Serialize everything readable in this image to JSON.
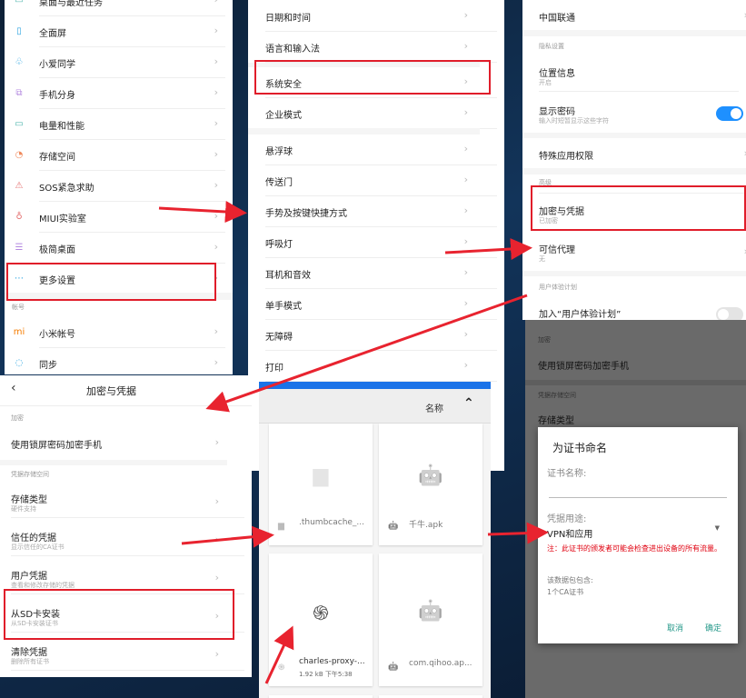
{
  "panel_a": {
    "items": [
      {
        "label": "桌面与最近任务",
        "icon": "desktop-icon",
        "color": "#4db6ac"
      },
      {
        "label": "全面屏",
        "icon": "phone-icon",
        "color": "#29a3e0"
      },
      {
        "label": "小爱同学",
        "icon": "xiaoai-icon",
        "color": "#29a3e0"
      },
      {
        "label": "手机分身",
        "icon": "dual-icon",
        "color": "#b48ae0"
      },
      {
        "label": "电量和性能",
        "icon": "battery-icon",
        "color": "#4db6ac"
      },
      {
        "label": "存储空间",
        "icon": "storage-icon",
        "color": "#f08a5d"
      },
      {
        "label": "SOS紧急求助",
        "icon": "warning-icon",
        "color": "#e57373"
      },
      {
        "label": "MIUI实验室",
        "icon": "flask-icon",
        "color": "#e57373"
      },
      {
        "label": "极简桌面",
        "icon": "simple-desktop-icon",
        "color": "#b48ae0"
      },
      {
        "label": "更多设置",
        "icon": "more-icon",
        "color": "#29a3e0"
      }
    ],
    "account_section": "帐号",
    "account_items": [
      {
        "label": "小米帐号",
        "icon": "mi-icon",
        "color": "#f57c00"
      },
      {
        "label": "同步",
        "icon": "sync-icon",
        "color": "#29a3e0"
      }
    ]
  },
  "panel_b": {
    "group1": [
      "日期和时间",
      "语言和输入法"
    ],
    "group2": [
      "系统安全",
      "企业模式"
    ],
    "group3": [
      "悬浮球",
      "传送门",
      "手势及按键快捷方式",
      "呼吸灯",
      "耳机和音效",
      "单手模式",
      "无障碍",
      "打印"
    ]
  },
  "panel_c": {
    "carrier": "中国联通",
    "privacy_section": "隐私设置",
    "location": {
      "title": "位置信息",
      "sub": "开启"
    },
    "show_password": {
      "title": "显示密码",
      "sub": "输入时短暂显示这些字符",
      "on": true
    },
    "special_perm": "特殊应用权限",
    "advanced_section": "高级",
    "encryption": {
      "title": "加密与凭据",
      "sub": "已加密"
    },
    "trust_agents": {
      "title": "可信代理",
      "sub": "无"
    },
    "ux_section": "用户体验计划",
    "ux_join": {
      "title": "加入“用户体验计划”",
      "on": false
    }
  },
  "panel_d": {
    "section1": "加密",
    "item1": "使用锁屏密码加密手机",
    "section2": "凭据存储空间",
    "item2": "存储类型",
    "dialog": {
      "title": "为证书命名",
      "name_label": "证书名称:",
      "name_value": "",
      "usage_label": "凭据用途:",
      "usage_value": "VPN和应用",
      "warning": "注：此证书的颁发者可能会检查进出设备的所有流量。",
      "contains_label": "该数据包包含:",
      "contains_value": "1个CA证书",
      "cancel": "取消",
      "ok": "确定",
      "accent": "#26998a",
      "warning_color": "#e0000f"
    }
  },
  "panel_e": {
    "title": "加密与凭据",
    "section1": "加密",
    "item_encrypt": "使用锁屏密码加密手机",
    "section2": "凭据存储空间",
    "items": [
      {
        "title": "存储类型",
        "sub": "硬件支持"
      },
      {
        "title": "信任的凭据",
        "sub": "显示信任的CA证书"
      },
      {
        "title": "用户凭据",
        "sub": "查看和修改存储的凭据"
      },
      {
        "title": "从SD卡安装",
        "sub": "从SD卡安装证书"
      },
      {
        "title": "清除凭据",
        "sub": "删除所有证书"
      }
    ]
  },
  "panel_f": {
    "sort_label": "名称",
    "accent": "#1a73e8",
    "files": [
      {
        "name": ".thumbcache_...",
        "icon": "file-icon"
      },
      {
        "name": "千牛.apk",
        "icon": "android-icon"
      },
      {
        "name": "charles-proxy-...",
        "meta": "1.92 kB 下午5:38",
        "icon": "fingerprint-icon"
      },
      {
        "name": "com.qihoo.ap...",
        "icon": "android-icon"
      }
    ]
  }
}
